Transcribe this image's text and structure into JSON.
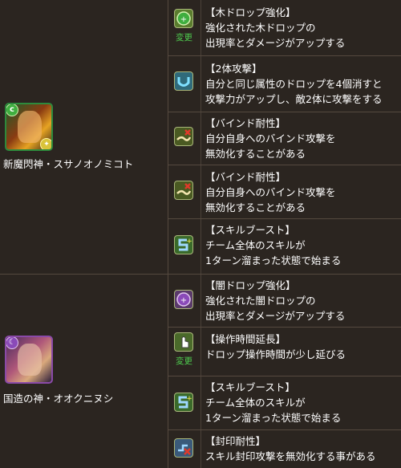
{
  "monsters": [
    {
      "name": "新魔閃神・スサノオノミコト",
      "attribute": "wood",
      "attr_icon": "leaf-icon"
    },
    {
      "name": "国造の神・オオクニヌシ",
      "attribute": "dark",
      "attr_icon": "moon-icon"
    }
  ],
  "awakenings": [
    {
      "icon": "wood-drop-enhance-icon",
      "change": "変更",
      "title": "【木ドロップ強化】",
      "lines": [
        "強化された木ドロップの",
        "出現率とダメージがアップする"
      ]
    },
    {
      "icon": "two-pronged-attack-icon",
      "change": "",
      "title": "【2体攻撃】",
      "lines": [
        "自分と同じ属性のドロップを4個消すと",
        "攻撃力がアップし、敵2体に攻撃をする"
      ]
    },
    {
      "icon": "bind-resist-icon",
      "change": "",
      "title": "【バインド耐性】",
      "lines": [
        "自分自身へのバインド攻撃を",
        "無効化することがある"
      ]
    },
    {
      "icon": "bind-resist-icon",
      "change": "",
      "title": "【バインド耐性】",
      "lines": [
        "自分自身へのバインド攻撃を",
        "無効化することがある"
      ]
    },
    {
      "icon": "skill-boost-icon",
      "change": "",
      "title": "【スキルブースト】",
      "lines": [
        "チーム全体のスキルが",
        "1ターン溜まった状態で始まる"
      ]
    },
    {
      "icon": "dark-drop-enhance-icon",
      "change": "",
      "title": "【闇ドロップ強化】",
      "lines": [
        "強化された闇ドロップの",
        "出現率とダメージがアップする"
      ]
    },
    {
      "icon": "time-extend-icon",
      "change": "変更",
      "title": "【操作時間延長】",
      "lines": [
        "ドロップ操作時間が少し延びる"
      ]
    },
    {
      "icon": "skill-boost-icon",
      "change": "",
      "title": "【スキルブースト】",
      "lines": [
        "チーム全体のスキルが",
        "1ターン溜まった状態で始まる"
      ]
    },
    {
      "icon": "seal-resist-icon",
      "change": "",
      "title": "【封印耐性】",
      "lines": [
        "スキル封印攻撃を無効化する事がある"
      ]
    }
  ],
  "colors": {
    "background": "#2b2520",
    "divider": "#55493f",
    "change_text": "#4fcf4f",
    "wood": "#3fae3f",
    "dark": "#8a4ab8"
  }
}
